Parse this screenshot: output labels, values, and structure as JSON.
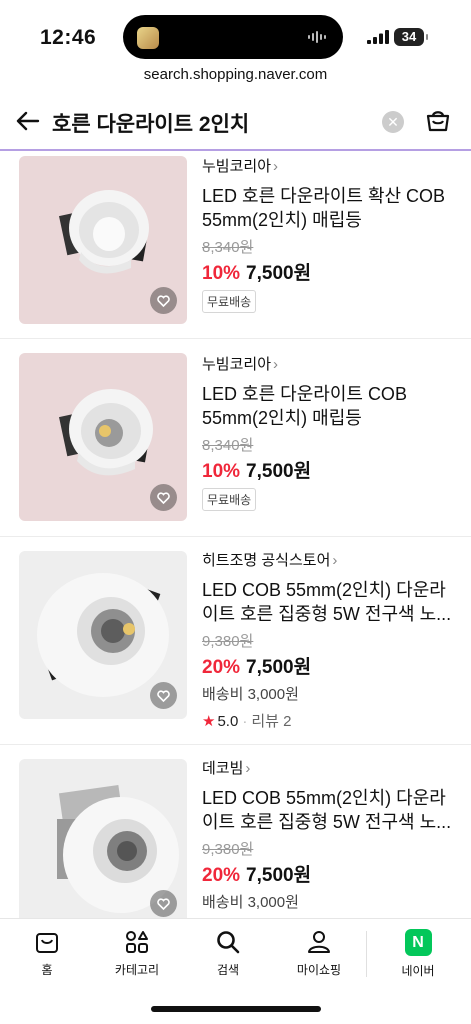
{
  "status_bar": {
    "time": "12:46",
    "battery": "34"
  },
  "browser": {
    "url": "search.shopping.naver.com"
  },
  "search": {
    "query": "호른 다운라이트 2인치",
    "clear_glyph": "✕"
  },
  "products": [
    {
      "store": "누빔코리아",
      "title_line1": "LED 호른 다운라이트 확산 COB",
      "title_line2": "55mm(2인치) 매립등",
      "original_price": "8,340원",
      "discount_rate": "10%",
      "price": "7,500원",
      "shipping_badge": "무료배송",
      "image_variant": "diffuse"
    },
    {
      "store": "누빔코리아",
      "title_line1": "LED 호른 다운라이트 COB",
      "title_line2": "55mm(2인치) 매립등",
      "original_price": "8,340원",
      "discount_rate": "10%",
      "price": "7,500원",
      "shipping_badge": "무료배송",
      "image_variant": "cob"
    },
    {
      "store": "히트조명 공식스토어",
      "title_line1": "LED COB 55mm(2인치) 다운라",
      "title_line2": "이트 호른 집중형 5W 전구색 노...",
      "original_price": "9,380원",
      "discount_rate": "20%",
      "price": "7,500원",
      "shipping": "배송비 3,000원",
      "rating_star": "★",
      "rating": "5.0",
      "review_sep": "·",
      "reviews": "리뷰 2",
      "image_variant": "cob-large"
    },
    {
      "store": "데코빔",
      "title_line1": "LED COB 55mm(2인치) 다운라",
      "title_line2": "이트 호른 집중형 5W 전구색 노...",
      "original_price": "9,380원",
      "discount_rate": "20%",
      "price": "7,500원",
      "shipping": "배송비 3,000원",
      "image_variant": "cob-side"
    }
  ],
  "tabbar": {
    "home": "홈",
    "category": "카테고리",
    "search": "검색",
    "my_shopping": "마이쇼핑",
    "naver": "네이버",
    "naver_logo": "N"
  },
  "colors": {
    "accent_red": "#f0273a",
    "header_underline": "#b59fe3",
    "naver_green": "#03c75a"
  }
}
